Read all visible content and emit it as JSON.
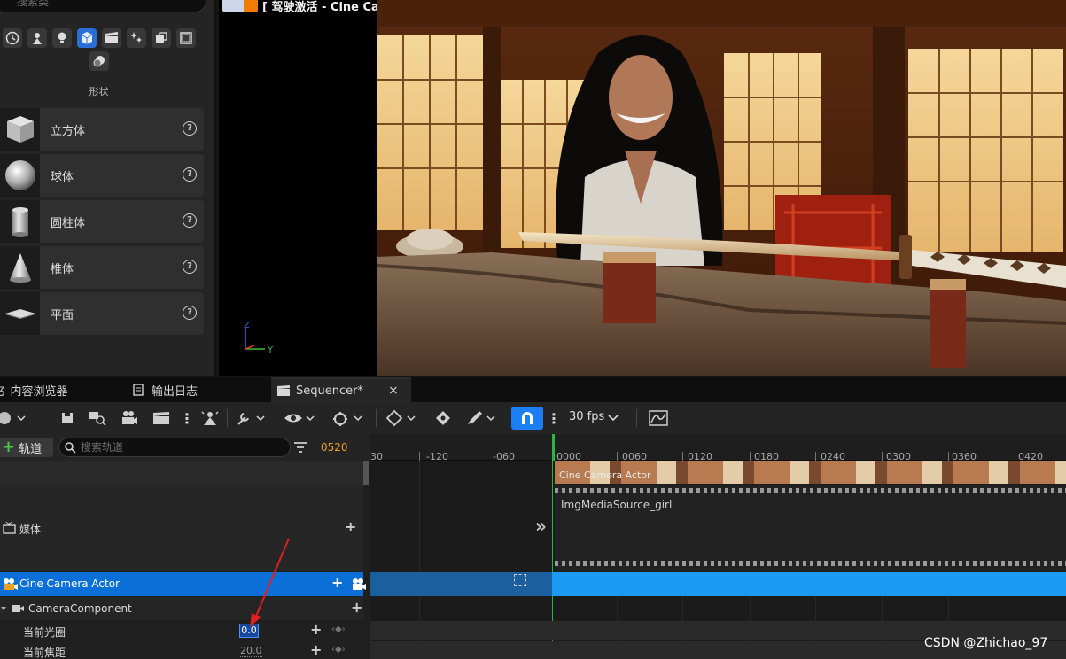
{
  "place_actors": {
    "search_placeholder": "搜索类",
    "category_title": "形状",
    "shapes": [
      {
        "label": "立方体",
        "icon": "cube-icon"
      },
      {
        "label": "球体",
        "icon": "sphere-icon"
      },
      {
        "label": "圆柱体",
        "icon": "cylinder-icon"
      },
      {
        "label": "椎体",
        "icon": "cone-icon"
      },
      {
        "label": "平面",
        "icon": "plane-icon"
      }
    ]
  },
  "viewport": {
    "title": "[ 驾驶激活 - Cine Camera Actor ]",
    "axis_z": "Z",
    "axis_y": "Y"
  },
  "tabs": [
    {
      "label": "内容浏览器",
      "active": false
    },
    {
      "label": "输出日志",
      "active": false
    },
    {
      "label": "Sequencer*",
      "active": true,
      "close": "×"
    }
  ],
  "toolbar": {
    "fps": "30 fps"
  },
  "track_header": {
    "add_track_label": "轨道",
    "search_placeholder": "搜索轨道",
    "current_frame": "0520"
  },
  "ruler": {
    "ticks": [
      "-120",
      "-060",
      "0000",
      "0060",
      "0120",
      "0180",
      "0240",
      "0300",
      "0360",
      "0420"
    ],
    "left_edge": "30"
  },
  "outliner": {
    "media_track": "媒体",
    "camera_actor": "Cine Camera Actor",
    "camera_component": "CameraComponent",
    "prop_aperture": "当前光圈",
    "prop_aperture_value": "0.0",
    "prop_focal": "当前焦距",
    "prop_focal_value": "20.0"
  },
  "timeline": {
    "camera_section_label": "Cine Camera Actor",
    "media_section_label": "ImgMediaSource_girl"
  },
  "watermark": "CSDN @Zhichao_97",
  "colors": {
    "accent_blue": "#1b7ef2",
    "selected_row": "#0a6fd6",
    "frame_orange": "#f0a020",
    "playhead_green": "#2bb34a"
  }
}
